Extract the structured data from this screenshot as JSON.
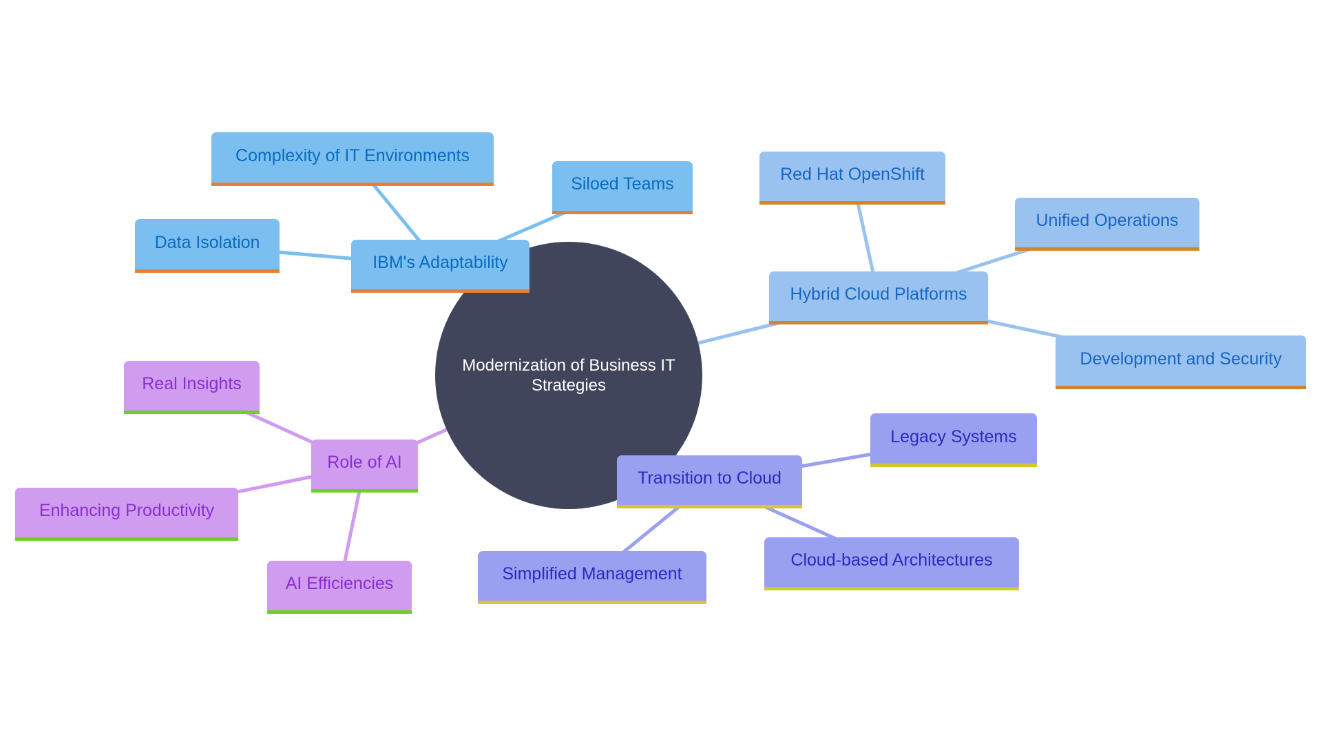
{
  "diagram": {
    "type": "mindmap",
    "root": {
      "id": "root",
      "label": "Modernization of Business IT Strategies"
    },
    "colors": {
      "root_fill": "#41455c",
      "root_text": "#ffffff",
      "adaptability_fill": "#7bbff0",
      "adaptability_text": "#0b6bbf",
      "adaptability_accent": "#e67e35",
      "hybrid_fill": "#9ac2f0",
      "hybrid_text": "#1766c2",
      "hybrid_accent": "#d4852a",
      "ai_fill": "#cf9cf0",
      "ai_text": "#8a2fd0",
      "ai_accent": "#6ccf2a",
      "cloud_fill": "#9aa0f0",
      "cloud_text": "#2a2ac0",
      "cloud_accent": "#d4c82a"
    },
    "branches": [
      {
        "id": "ibm",
        "label": "IBM's Adaptability",
        "children": [
          {
            "id": "complexity",
            "label": "Complexity of IT Environments"
          },
          {
            "id": "siloed",
            "label": "Siloed Teams"
          },
          {
            "id": "dataiso",
            "label": "Data Isolation"
          }
        ]
      },
      {
        "id": "hybrid",
        "label": "Hybrid Cloud Platforms",
        "children": [
          {
            "id": "redhat",
            "label": "Red Hat OpenShift"
          },
          {
            "id": "unified",
            "label": "Unified Operations"
          },
          {
            "id": "devsec",
            "label": "Development and Security"
          }
        ]
      },
      {
        "id": "ai",
        "label": "Role of AI",
        "children": [
          {
            "id": "insights",
            "label": "Real Insights"
          },
          {
            "id": "productivity",
            "label": "Enhancing Productivity"
          },
          {
            "id": "efficiencies",
            "label": "AI Efficiencies"
          }
        ]
      },
      {
        "id": "cloud",
        "label": "Transition to Cloud",
        "children": [
          {
            "id": "legacy",
            "label": "Legacy Systems"
          },
          {
            "id": "simplified",
            "label": "Simplified Management"
          },
          {
            "id": "cloudarch",
            "label": "Cloud-based Architectures"
          }
        ]
      }
    ]
  }
}
